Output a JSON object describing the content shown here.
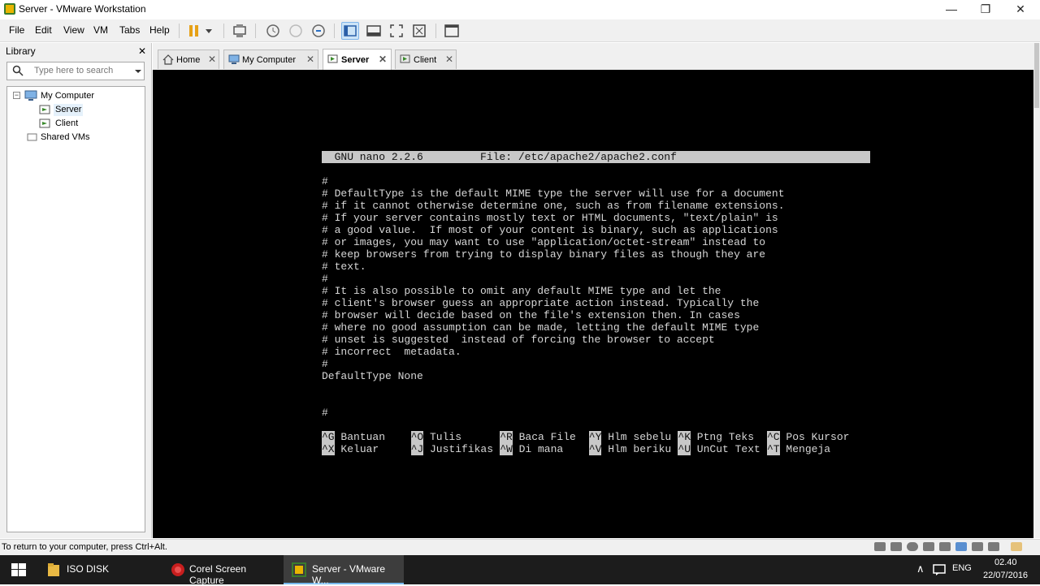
{
  "window": {
    "title": "Server - VMware Workstation",
    "controls": {
      "minimize": "—",
      "restore": "❐",
      "close": "✕"
    }
  },
  "menu": [
    "File",
    "Edit",
    "View",
    "VM",
    "Tabs",
    "Help"
  ],
  "toolbar": {
    "icons": [
      "pause-icon",
      "dropdown-icon",
      "send-ctrl-alt-del-icon",
      "snapshot-icon",
      "revert-snapshot-icon",
      "snapshot-manager-icon",
      "console-view-icon",
      "fullscreen-icon",
      "unity-icon",
      "thumbnail-icon",
      "library-view-icon"
    ],
    "accent": "#e6a117"
  },
  "library": {
    "title": "Library",
    "close": "✕",
    "search_placeholder": "Type here to search",
    "tree": {
      "root": "My Computer",
      "expander": "−",
      "children": [
        "Server",
        "Client"
      ],
      "shared": "Shared VMs"
    }
  },
  "tabs": [
    {
      "label": "Home",
      "close": "✕"
    },
    {
      "label": "My Computer",
      "close": "✕"
    },
    {
      "label": "Server",
      "close": "✕"
    },
    {
      "label": "Client",
      "close": "✕"
    }
  ],
  "terminal": {
    "header": "  GNU nano 2.2.6         File: /etc/apache2/apache2.conf",
    "lines": [
      "",
      "#",
      "# DefaultType is the default MIME type the server will use for a document",
      "# if it cannot otherwise determine one, such as from filename extensions.",
      "# If your server contains mostly text or HTML documents, \"text/plain\" is",
      "# a good value.  If most of your content is binary, such as applications",
      "# or images, you may want to use \"application/octet-stream\" instead to",
      "# keep browsers from trying to display binary files as though they are",
      "# text.",
      "#",
      "# It is also possible to omit any default MIME type and let the",
      "# client's browser guess an appropriate action instead. Typically the",
      "# browser will decide based on the file's extension then. In cases",
      "# where no good assumption can be made, letting the default MIME type",
      "# unset is suggested  instead of forcing the browser to accept",
      "# incorrect  metadata.",
      "#",
      "DefaultType None",
      "",
      "",
      "#"
    ],
    "shortcuts_row1": [
      {
        "key": "^G",
        "label": " Bantuan"
      },
      {
        "key": "^O",
        "label": " Tulis"
      },
      {
        "key": "^R",
        "label": " Baca File"
      },
      {
        "key": "^Y",
        "label": " Hlm sebelu"
      },
      {
        "key": "^K",
        "label": " Ptng Teks"
      },
      {
        "key": "^C",
        "label": " Pos Kursor"
      }
    ],
    "shortcuts_row2": [
      {
        "key": "^X",
        "label": " Keluar"
      },
      {
        "key": "^J",
        "label": " Justifikas"
      },
      {
        "key": "^W",
        "label": " Di mana"
      },
      {
        "key": "^V",
        "label": " Hlm beriku"
      },
      {
        "key": "^U",
        "label": " UnCut Text"
      },
      {
        "key": "^T",
        "label": " Mengeja"
      }
    ]
  },
  "statusbar": {
    "message": "To return to your computer, press Ctrl+Alt."
  },
  "taskbar": {
    "items": [
      "ISO DISK",
      "Corel Screen Capture",
      "Server - VMware W..."
    ],
    "language": "ENG",
    "time": "02.40",
    "date": "22/07/2016",
    "tray_up": "∧"
  }
}
